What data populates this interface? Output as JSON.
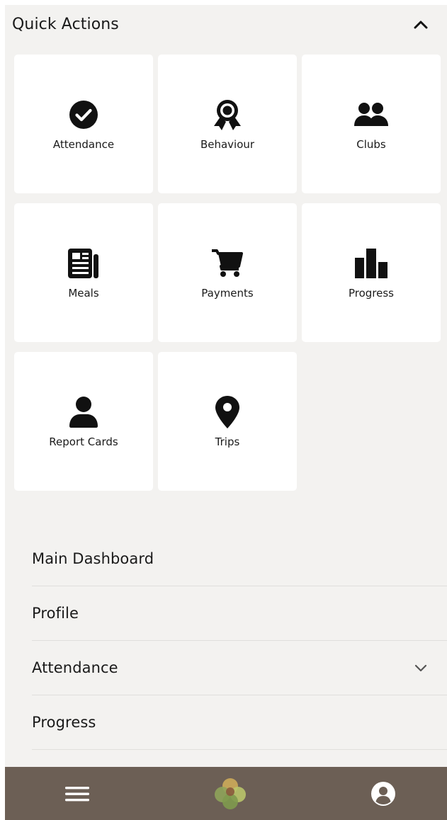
{
  "quick_actions": {
    "title": "Quick Actions",
    "collapse_icon": "chevron-up-icon",
    "items": [
      {
        "label": "Attendance",
        "icon": "check-circle-icon"
      },
      {
        "label": "Behaviour",
        "icon": "award-ribbon-icon"
      },
      {
        "label": "Clubs",
        "icon": "users-icon"
      },
      {
        "label": "Meals",
        "icon": "newspaper-icon"
      },
      {
        "label": "Payments",
        "icon": "shopping-cart-icon"
      },
      {
        "label": "Progress",
        "icon": "bar-chart-icon"
      },
      {
        "label": "Report Cards",
        "icon": "user-icon"
      },
      {
        "label": "Trips",
        "icon": "map-marker-icon"
      }
    ]
  },
  "menu": {
    "items": [
      {
        "label": "Main Dashboard"
      },
      {
        "label": "Profile"
      },
      {
        "label": "Attendance",
        "expand_icon": "chevron-down-icon"
      },
      {
        "label": "Progress"
      }
    ]
  },
  "bottom_bar": {
    "menu_icon": "hamburger-menu-icon",
    "logo_icon": "clover-logo-icon",
    "account_icon": "user-circle-icon"
  },
  "colors": {
    "background": "#f3f2f0",
    "tile": "#ffffff",
    "bottom_bar": "#6c5f55",
    "divider": "#e0dfdc",
    "text": "#1a1a1a"
  }
}
